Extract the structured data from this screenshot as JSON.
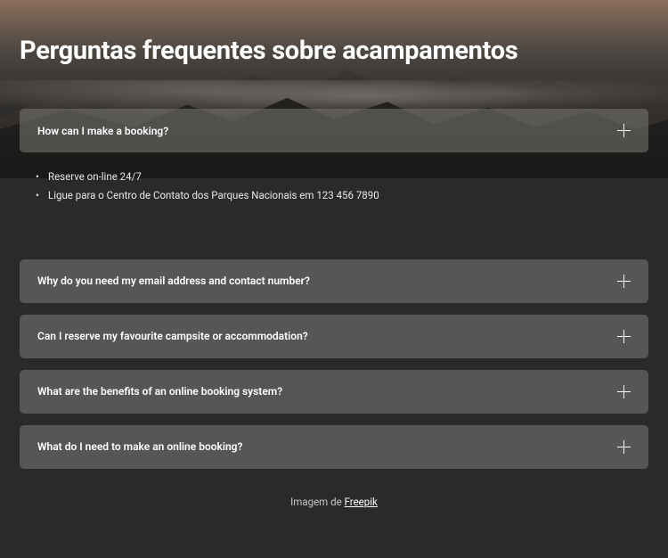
{
  "header": {
    "title": "Perguntas frequentes sobre acampamentos"
  },
  "faq": {
    "items": [
      {
        "question": "How can I make a booking?",
        "expanded": true,
        "answers": [
          "Reserve on-line 24/7",
          "Ligue para o Centro de Contato dos Parques Nacionais em 123 456 7890"
        ]
      },
      {
        "question": "Why do you need my email address and contact number?",
        "expanded": false
      },
      {
        "question": "Can I reserve my favourite campsite or accommodation?",
        "expanded": false
      },
      {
        "question": "What are the benefits of an online booking system?",
        "expanded": false
      },
      {
        "question": "What do I need to make an online booking?",
        "expanded": false
      }
    ]
  },
  "footer": {
    "credit_prefix": "Imagem de ",
    "credit_link": "Freepik"
  }
}
